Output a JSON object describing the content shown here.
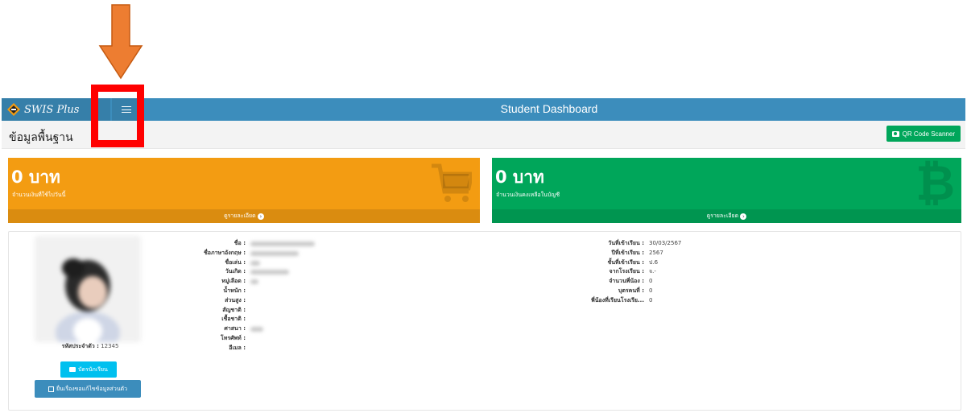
{
  "navbar": {
    "brand": "SWIS Plus",
    "title": "Student Dashboard"
  },
  "page": {
    "title": "ข้อมูลพื้นฐาน",
    "qr_button": "QR Code Scanner"
  },
  "stats": [
    {
      "amount": "0 บาท",
      "description": "จำนวนเงินที่ใช้ไปวันนี้",
      "footer": "ดูรายละเอียด",
      "color": "#f39c12",
      "icon": "shopping-cart-icon"
    },
    {
      "amount": "0 บาท",
      "description": "จำนวนเงินคงเหลือในบัญชี",
      "footer": "ดูรายละเอียด",
      "color": "#00a65a",
      "icon": "bitcoin-icon"
    }
  ],
  "profile": {
    "student_code_label": "รหัสประจำตัว :",
    "student_code": "12345",
    "card_button": "บัตรนักเรียน",
    "edit_button": "ยื่นเรื่องขอแก้ไขข้อมูลส่วนตัว",
    "left_fields": [
      {
        "label": "ชื่อ :"
      },
      {
        "label": "ชื่อภาษาอังกฤษ :"
      },
      {
        "label": "ชื่อเล่น :"
      },
      {
        "label": "วันเกิด :"
      },
      {
        "label": "หมู่เลือด :"
      },
      {
        "label": "น้ำหนัก :"
      },
      {
        "label": "ส่วนสูง :"
      },
      {
        "label": "สัญชาติ :"
      },
      {
        "label": "เชื้อชาติ :"
      },
      {
        "label": "ศาสนา :"
      },
      {
        "label": "โทรศัพท์ :"
      },
      {
        "label": "อีเมล :"
      }
    ],
    "right_fields": [
      {
        "label": "วันที่เข้าเรียน :",
        "value": "30/03/2567"
      },
      {
        "label": "ปีที่เข้าเรียน :",
        "value": "2567"
      },
      {
        "label": "ชั้นที่เข้าเรียน :",
        "value": "ป.6"
      },
      {
        "label": "จากโรงเรียน :",
        "value": "จ.-"
      },
      {
        "label": "จำนวนพี่น้อง :",
        "value": "0"
      },
      {
        "label": "บุตรคนที่ :",
        "value": "0"
      },
      {
        "label": "พี่น้องที่เรียนโรงเรีย...",
        "value": "0"
      }
    ]
  },
  "colors": {
    "navbar": "#3c8dbc",
    "annotation_box": "#ff0000",
    "annotation_arrow": "#ed7d31"
  }
}
